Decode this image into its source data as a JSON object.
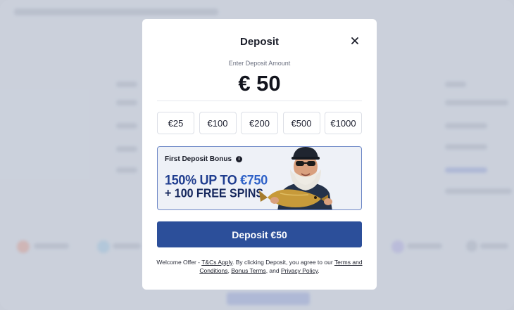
{
  "modal": {
    "title": "Deposit",
    "amount_label": "Enter Deposit Amount",
    "amount_value": "€ 50",
    "presets": [
      "€25",
      "€100",
      "€200",
      "€500",
      "€1000"
    ],
    "bonus": {
      "heading": "First Deposit Bonus",
      "line1_prefix": "150% UP TO ",
      "line1_highlight": "€750",
      "line2": "+ 100 FREE SPINS"
    },
    "deposit_button": "Deposit €50",
    "legal": {
      "prefix": "Welcome Offer - ",
      "tcs_link": "T&Cs Apply",
      "middle": ". By clicking Deposit, you agree to our ",
      "terms_link": "Terms and Conditions",
      "comma": ", ",
      "bonus_terms_link": "Bonus Terms",
      "and": ", and ",
      "privacy_link": "Privacy Policy",
      "end": "."
    }
  },
  "colors": {
    "accent": "#2c4f9a",
    "bonus_border": "#6f89c7",
    "highlight": "#2f62c8"
  },
  "icons": [
    "close-icon",
    "info-icon"
  ]
}
